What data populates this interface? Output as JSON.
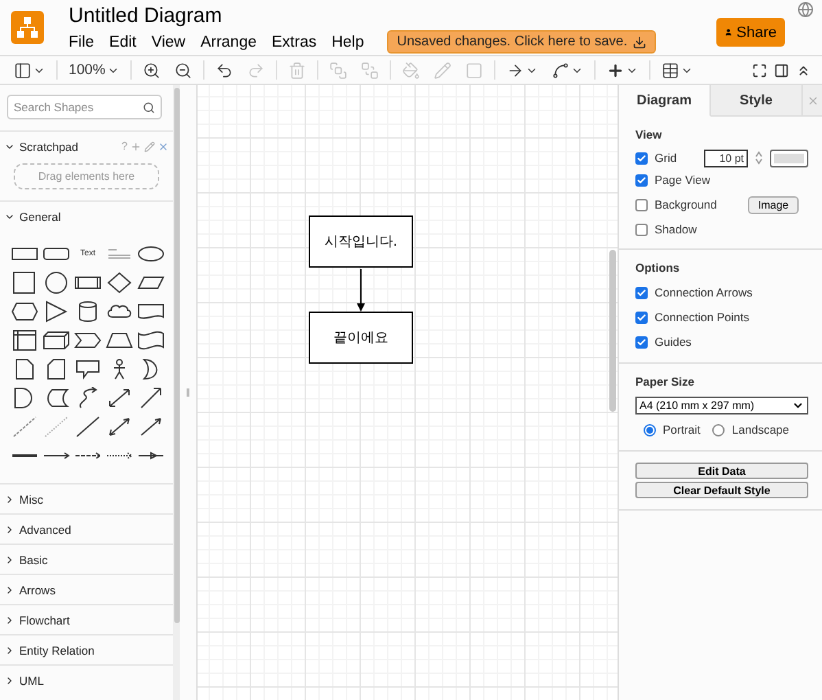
{
  "window": {
    "title": "Untitled Diagram"
  },
  "menu": [
    "File",
    "Edit",
    "View",
    "Arrange",
    "Extras",
    "Help"
  ],
  "save_notice": "Unsaved changes. Click here to save.",
  "share_button": "Share",
  "toolbar": [
    {
      "kind": "panel",
      "disabled": false
    },
    {
      "kind": "zoom-level",
      "label": "100%",
      "disabled": false
    },
    {
      "kind": "zoom-in",
      "disabled": false
    },
    {
      "kind": "zoom-out",
      "disabled": false
    },
    {
      "kind": "undo",
      "disabled": false
    },
    {
      "kind": "redo",
      "disabled": true
    },
    {
      "kind": "delete",
      "disabled": true
    },
    {
      "kind": "to-front",
      "disabled": true
    },
    {
      "kind": "to-back",
      "disabled": true
    },
    {
      "kind": "fill",
      "disabled": true
    },
    {
      "kind": "line",
      "disabled": true
    },
    {
      "kind": "shadow",
      "disabled": true
    },
    {
      "kind": "connection",
      "disabled": false
    },
    {
      "kind": "waypoint",
      "disabled": false
    },
    {
      "kind": "insert",
      "disabled": false
    },
    {
      "kind": "table",
      "disabled": false
    }
  ],
  "sidebar": {
    "search": {
      "placeholder": "Search Shapes"
    },
    "scratchpad": {
      "title": "Scratchpad",
      "expanded": true,
      "help": "?",
      "drop_hint": "Drag elements here"
    },
    "general": {
      "title": "General",
      "expanded": true,
      "text_shape": "Text"
    },
    "categories": [
      {
        "title": "Misc",
        "expanded": false
      },
      {
        "title": "Advanced",
        "expanded": false
      },
      {
        "title": "Basic",
        "expanded": false
      },
      {
        "title": "Arrows",
        "expanded": false
      },
      {
        "title": "Flowchart",
        "expanded": false
      },
      {
        "title": "Entity Relation",
        "expanded": false
      },
      {
        "title": "UML",
        "expanded": false
      }
    ]
  },
  "canvas": {
    "nodes": [
      {
        "label": "시작입니다."
      },
      {
        "label": "끝이에요"
      }
    ]
  },
  "format_panel": {
    "tabs": [
      {
        "label": "Diagram",
        "selected": true
      },
      {
        "label": "Style",
        "selected": false
      }
    ],
    "view": {
      "title": "View",
      "grid": {
        "label": "Grid",
        "checked": true,
        "size": "10 pt"
      },
      "options": [
        {
          "label": "Page View",
          "checked": true
        },
        {
          "label": "Background",
          "checked": false,
          "button": "Image"
        },
        {
          "label": "Shadow",
          "checked": false
        }
      ]
    },
    "options": {
      "title": "Options",
      "items": [
        {
          "label": "Connection Arrows",
          "checked": true
        },
        {
          "label": "Connection Points",
          "checked": true
        },
        {
          "label": "Guides",
          "checked": true
        }
      ]
    },
    "paper_size": {
      "title": "Paper Size",
      "value": "A4 (210 mm x 297 mm)",
      "orientations": [
        {
          "label": "Portrait",
          "selected": true
        },
        {
          "label": "Landscape",
          "selected": false
        }
      ]
    },
    "buttons": [
      "Edit Data",
      "Clear Default Style"
    ]
  }
}
